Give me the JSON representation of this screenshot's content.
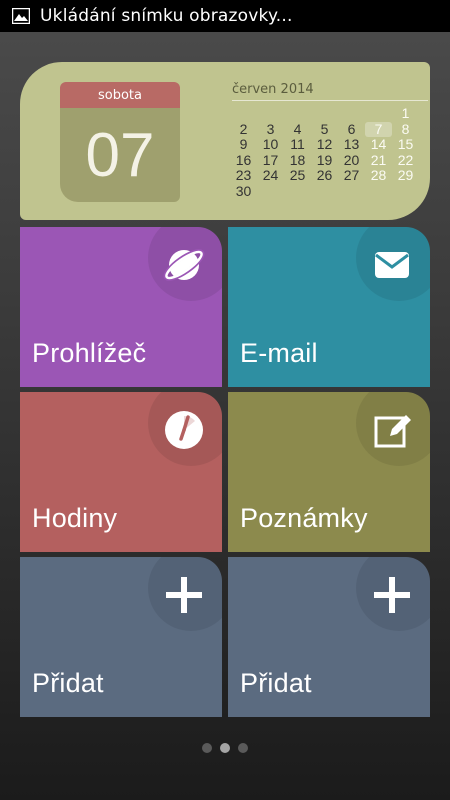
{
  "status_bar": {
    "notification_text": "Ukládání snímku obrazovky..."
  },
  "calendar": {
    "weekday": "sobota",
    "day": "07",
    "month_title": "červen 2014",
    "weeks": [
      [
        "",
        "",
        "",
        "",
        "",
        "",
        "1"
      ],
      [
        "2",
        "3",
        "4",
        "5",
        "6",
        "7",
        "8"
      ],
      [
        "9",
        "10",
        "11",
        "12",
        "13",
        "14",
        "15"
      ],
      [
        "16",
        "17",
        "18",
        "19",
        "20",
        "21",
        "22"
      ],
      [
        "23",
        "24",
        "25",
        "26",
        "27",
        "28",
        "29"
      ],
      [
        "30",
        "",
        "",
        "",
        "",
        "",
        ""
      ]
    ],
    "today": "7"
  },
  "tiles": {
    "browser": {
      "label": "Prohlížeč",
      "color": "#9b56b5",
      "icon": "browser-icon"
    },
    "email": {
      "label": "E-mail",
      "color": "#2e8fa2",
      "icon": "mail-icon"
    },
    "clock": {
      "label": "Hodiny",
      "color": "#b4605f",
      "icon": "clock-icon"
    },
    "notes": {
      "label": "Poznámky",
      "color": "#8c8a4d",
      "icon": "note-edit-icon"
    },
    "add1": {
      "label": "Přidat",
      "color": "#5b6b80",
      "icon": "plus-icon"
    },
    "add2": {
      "label": "Přidat",
      "color": "#5b6b80",
      "icon": "plus-icon"
    }
  },
  "pager": {
    "pages": 3,
    "current_page": 2
  }
}
